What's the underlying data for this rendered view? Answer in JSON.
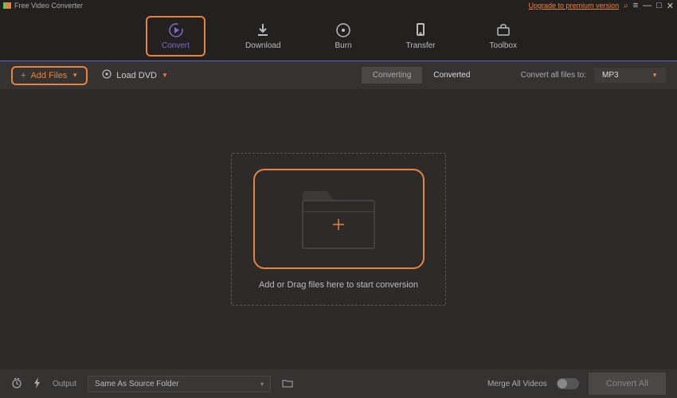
{
  "titlebar": {
    "app_name": "Free Video Converter",
    "upgrade_text": "Upgrade to premium version"
  },
  "nav": {
    "convert": "Convert",
    "download": "Download",
    "burn": "Burn",
    "transfer": "Transfer",
    "toolbox": "Toolbox"
  },
  "toolbar": {
    "add_files": "Add Files",
    "load_dvd": "Load DVD",
    "tab_converting": "Converting",
    "tab_converted": "Converted",
    "convert_all_label": "Convert all files to:",
    "format": "MP3"
  },
  "dropzone": {
    "text": "Add or Drag files here to start conversion"
  },
  "footer": {
    "output_label": "Output",
    "output_value": "Same As Source Folder",
    "merge_label": "Merge All Videos",
    "convert_all_btn": "Convert All"
  }
}
